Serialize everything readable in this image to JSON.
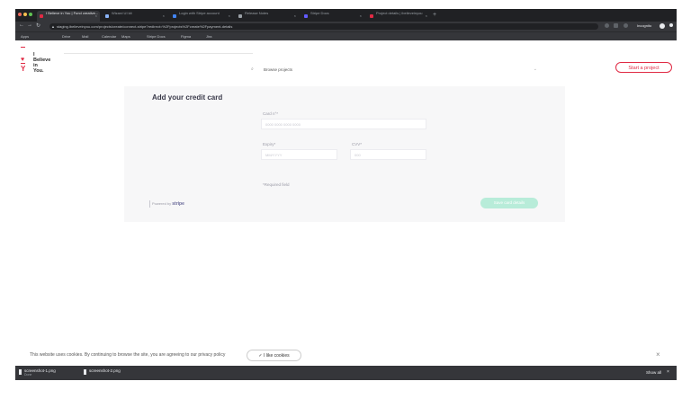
{
  "browser": {
    "tabs": [
      {
        "label": "I Believe in You | Fund creative...",
        "active": true
      },
      {
        "label": "Wizard UI kit",
        "active": false
      },
      {
        "label": "Login with Stripe account",
        "active": false
      },
      {
        "label": "Release Notes",
        "active": false
      },
      {
        "label": "Stripe Docs",
        "active": false
      },
      {
        "label": "Project details | ibelieveinyou",
        "active": false
      }
    ],
    "close_glyph": "×",
    "new_tab": "+",
    "url": "staging.ibelieveinyou.com/projects/create/connect-stripe?redirect=%2Fprojects%2Fcreate%2Fpayment-details",
    "profile_label": "Incognito",
    "bookmarks": [
      "Apps",
      "Drive",
      "Mail",
      "Calendar",
      "Maps",
      "Stripe Docs",
      "Figma",
      "Jira"
    ]
  },
  "header": {
    "logo_lines": [
      "I",
      "Believe",
      "in",
      "You."
    ],
    "search_placeholder": "Browse projects",
    "start_project": "Start a project"
  },
  "card": {
    "title": "Add your credit card",
    "card_number_label": "Card n°*",
    "card_number_placeholder": "0000 0000 0000 0000",
    "expiry_label": "Expiry*",
    "expiry_placeholder": "MM/YYYY",
    "cvv_label": "CVV*",
    "cvv_placeholder": "000",
    "required_note": "*Required field",
    "powered_by": "Powered by",
    "stripe": "stripe",
    "save_button": "Save card details"
  },
  "cookies": {
    "message": "This website uses cookies. By continuing to browse the site, you are agreeing to our privacy policy",
    "button": "I like cookies",
    "close": "×"
  },
  "downloads": {
    "items": [
      {
        "name": "screenshot-1.png",
        "status": "Done"
      },
      {
        "name": "screenshot-2.png",
        "status": ""
      }
    ],
    "show_all": "Show all"
  },
  "colors": {
    "brand": "#e02a44",
    "save_button_bg": "#b8ecd9",
    "chrome_dark": "#202124",
    "chrome_mid": "#35363a",
    "card_bg": "#f7f7f8"
  }
}
